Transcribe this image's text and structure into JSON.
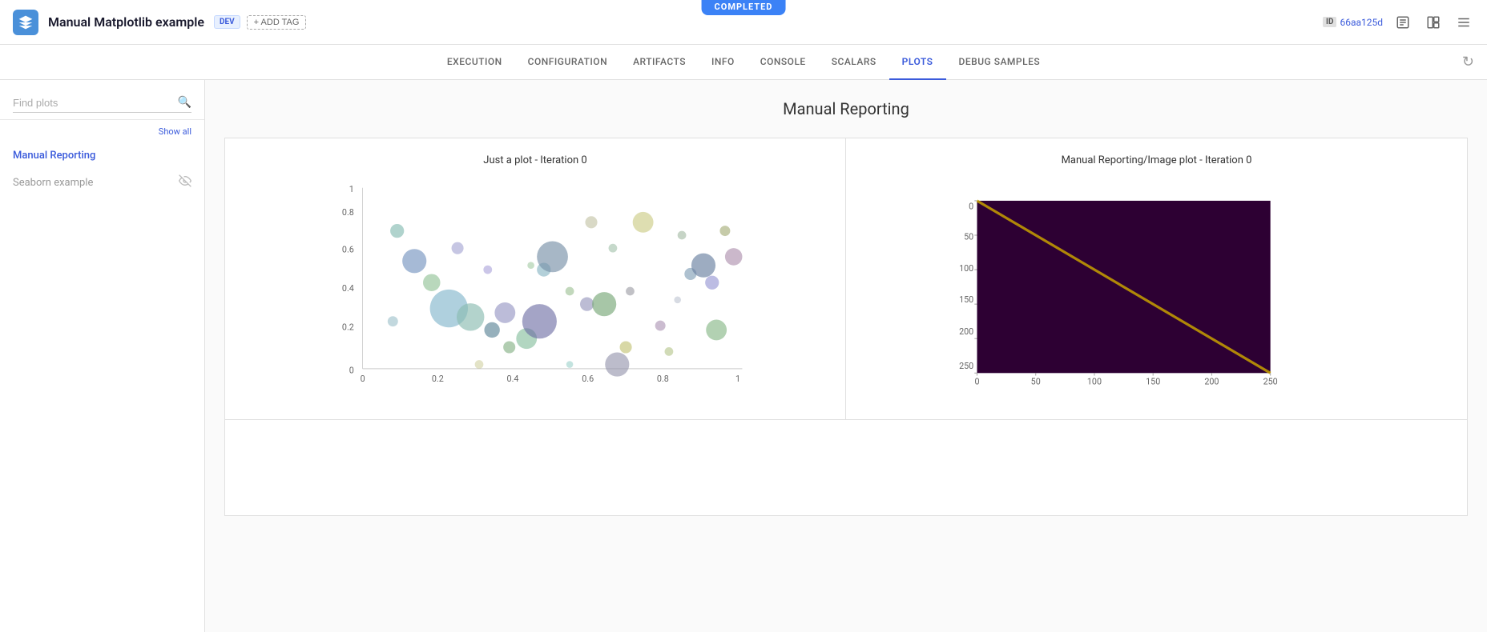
{
  "header": {
    "title": "Manual Matplotlib example",
    "tag": "DEV",
    "add_tag_label": "+ ADD TAG",
    "id_label": "ID",
    "id_value": "66aa125d",
    "completed_label": "COMPLETED"
  },
  "nav": {
    "tabs": [
      {
        "label": "EXECUTION",
        "active": false
      },
      {
        "label": "CONFIGURATION",
        "active": false
      },
      {
        "label": "ARTIFACTS",
        "active": false
      },
      {
        "label": "INFO",
        "active": false
      },
      {
        "label": "CONSOLE",
        "active": false
      },
      {
        "label": "SCALARS",
        "active": false
      },
      {
        "label": "PLOTS",
        "active": true
      },
      {
        "label": "DEBUG SAMPLES",
        "active": false
      }
    ]
  },
  "sidebar": {
    "search_placeholder": "Find plots",
    "show_all_label": "Show all",
    "items": [
      {
        "label": "Manual Reporting",
        "active": true,
        "hidden": false
      },
      {
        "label": "Seaborn example",
        "active": false,
        "hidden": true
      }
    ]
  },
  "main": {
    "page_title": "Manual Reporting",
    "plots": [
      {
        "title": "Just a plot - Iteration 0",
        "type": "scatter"
      },
      {
        "title": "Manual Reporting/Image plot - Iteration 0",
        "type": "matrix"
      }
    ]
  }
}
